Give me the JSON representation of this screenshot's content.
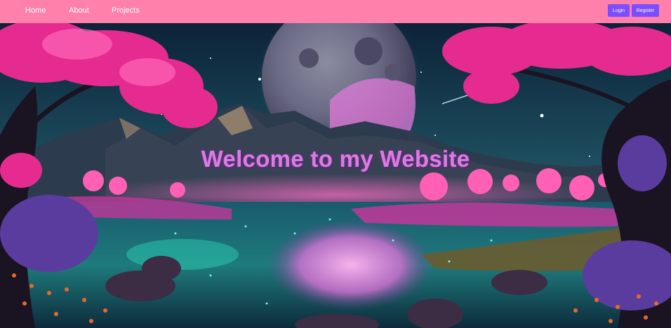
{
  "nav": {
    "links": [
      {
        "label": "Home"
      },
      {
        "label": "About"
      },
      {
        "label": "Projects"
      }
    ],
    "login_label": "Login",
    "register_label": "Register"
  },
  "hero": {
    "title": "Welcome to my Website"
  },
  "colors": {
    "navbar": "#ff80ab",
    "button": "#7c4dff",
    "title": "#d77ee0"
  }
}
